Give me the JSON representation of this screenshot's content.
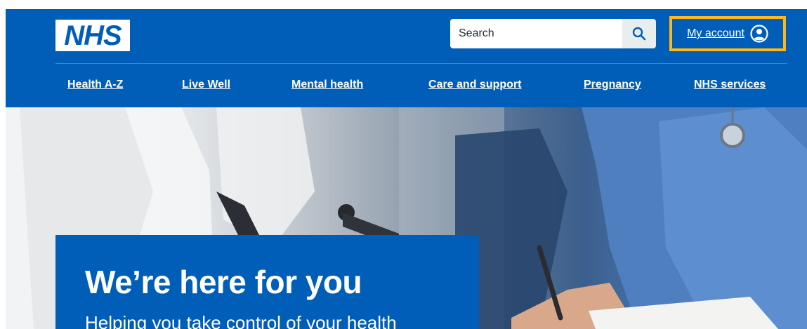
{
  "header": {
    "logo_text": "NHS",
    "search": {
      "placeholder": "Search",
      "value": ""
    },
    "account_label": "My account"
  },
  "nav": {
    "items": [
      {
        "label": "Health A-Z"
      },
      {
        "label": "Live Well"
      },
      {
        "label": "Mental health"
      },
      {
        "label": "Care and support"
      },
      {
        "label": "Pregnancy"
      },
      {
        "label": "NHS services"
      }
    ]
  },
  "hero": {
    "title": "We’re here for you",
    "subtitle": "Helping you take control of your health"
  },
  "icons": {
    "search": "search-icon",
    "account": "user-circle-icon"
  },
  "colors": {
    "brand_blue": "#005eb8",
    "focus_highlight": "#ffb81c",
    "white": "#ffffff"
  }
}
